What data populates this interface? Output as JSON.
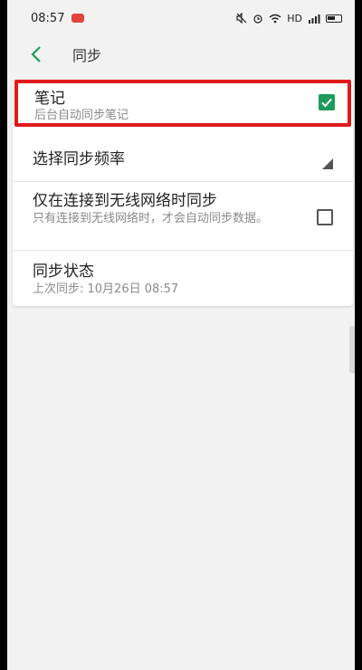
{
  "status_bar": {
    "time": "08:57",
    "network": "HD"
  },
  "app_bar": {
    "title": "同步"
  },
  "settings": [
    {
      "title": "笔记",
      "subtitle": "后台自动同步笔记",
      "checked": true
    },
    {
      "title": "选择同步频率"
    },
    {
      "title": "仅在连接到无线网络时同步",
      "subtitle": "只有连接到无线网络时，才会自动同步数据。",
      "checked": false
    },
    {
      "title": "同步状态",
      "subtitle": "上次同步: 10月26日 08:57"
    }
  ],
  "colors": {
    "accent": "#1d9b5a",
    "highlight": "#e01a1a"
  }
}
